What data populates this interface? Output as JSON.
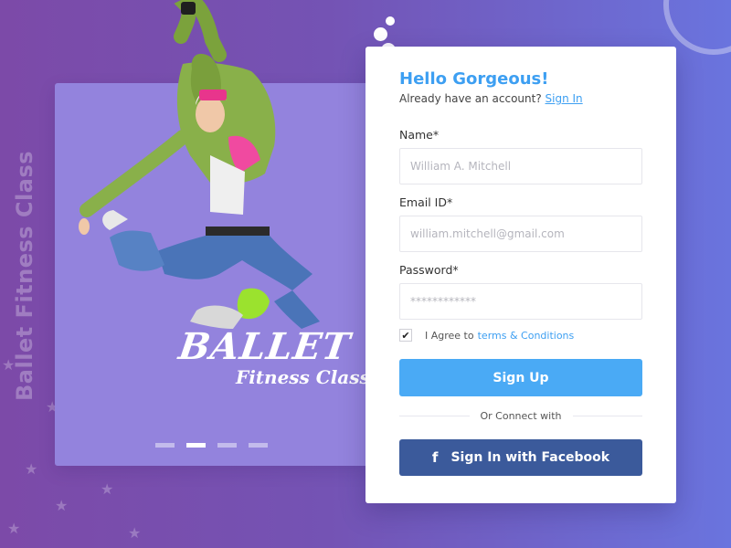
{
  "background": {
    "colors": {
      "start": "#7c4aa8",
      "end": "#6a74de"
    },
    "vertical_label": "Ballet Fitness Class"
  },
  "hero": {
    "card_color": "#9383dd",
    "title": "BALLET",
    "subtitle": "Fitness Class",
    "slides": {
      "count": 4,
      "active_index": 1
    }
  },
  "form": {
    "greeting": "Hello Gorgeous!",
    "account_prompt": "Already have an account?",
    "signin_link": "Sign In",
    "fields": {
      "name": {
        "label": "Name*",
        "placeholder": "William A. Mitchell"
      },
      "email": {
        "label": "Email ID*",
        "placeholder": "william.mitchell@gmail.com"
      },
      "password": {
        "label": "Password*",
        "placeholder": "************"
      }
    },
    "agree": {
      "checked": true,
      "check_mark": "✔",
      "text": "I Agree to",
      "terms_link": "terms & Conditions"
    },
    "signup_button": "Sign Up",
    "divider_text": "Or Connect with",
    "facebook_button": "Sign In with Facebook",
    "facebook_icon": "f",
    "colors": {
      "accent": "#3d9ff2",
      "signup_button": "#4aaaf5",
      "facebook_button": "#3b5a9b"
    }
  }
}
